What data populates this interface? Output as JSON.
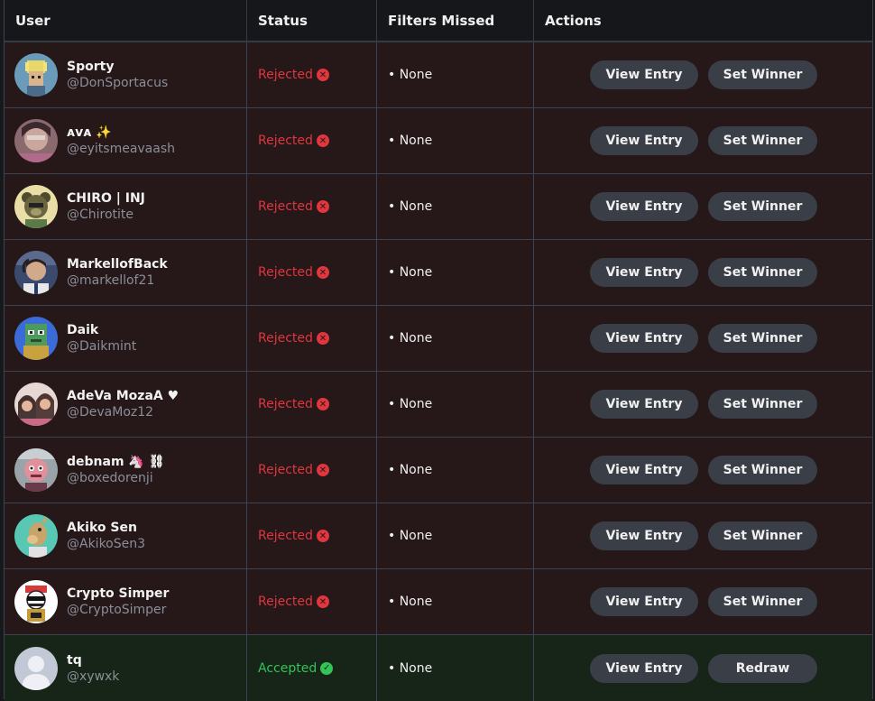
{
  "headers": {
    "user": "User",
    "status": "Status",
    "filters": "Filters Missed",
    "actions": "Actions"
  },
  "colors": {
    "rejected": "#e0363e",
    "accepted": "#33c457",
    "button_bg": "#3a3f47",
    "row_rejected_bg": "#261719",
    "row_accepted_bg": "#172418"
  },
  "rows": [
    {
      "name": "Sporty",
      "handle": "@DonSportacus",
      "status": "Rejected",
      "status_icon": "x-circle-icon",
      "filters": "• None",
      "view_label": "View Entry",
      "second_label": "Set Winner"
    },
    {
      "name": "ᴀᴠᴀ ✨",
      "handle": "@eyitsmeavaash",
      "status": "Rejected",
      "status_icon": "x-circle-icon",
      "filters": "• None",
      "view_label": "View Entry",
      "second_label": "Set Winner"
    },
    {
      "name": "CHIRO | INJ",
      "handle": "@Chirotite",
      "status": "Rejected",
      "status_icon": "x-circle-icon",
      "filters": "• None",
      "view_label": "View Entry",
      "second_label": "Set Winner"
    },
    {
      "name": "MarkellofBack",
      "handle": "@markellof21",
      "status": "Rejected",
      "status_icon": "x-circle-icon",
      "filters": "• None",
      "view_label": "View Entry",
      "second_label": "Set Winner"
    },
    {
      "name": "Daik",
      "handle": "@Daikmint",
      "status": "Rejected",
      "status_icon": "x-circle-icon",
      "filters": "• None",
      "view_label": "View Entry",
      "second_label": "Set Winner"
    },
    {
      "name": "AdeVa MozaA ♥",
      "handle": "@DevaMoz12",
      "status": "Rejected",
      "status_icon": "x-circle-icon",
      "filters": "• None",
      "view_label": "View Entry",
      "second_label": "Set Winner"
    },
    {
      "name": "debnam 🦄 ⛓",
      "handle": "@boxedorenji",
      "status": "Rejected",
      "status_icon": "x-circle-icon",
      "filters": "• None",
      "view_label": "View Entry",
      "second_label": "Set Winner"
    },
    {
      "name": "Akiko Sen",
      "handle": "@AkikoSen3",
      "status": "Rejected",
      "status_icon": "x-circle-icon",
      "filters": "• None",
      "view_label": "View Entry",
      "second_label": "Set Winner"
    },
    {
      "name": "Crypto Simper",
      "handle": "@CryptoSimper",
      "status": "Rejected",
      "status_icon": "x-circle-icon",
      "filters": "• None",
      "view_label": "View Entry",
      "second_label": "Set Winner"
    },
    {
      "name": "tq",
      "handle": "@xywxk",
      "status": "Accepted",
      "status_icon": "check-circle-icon",
      "filters": "• None",
      "view_label": "View Entry",
      "second_label": "Redraw"
    }
  ]
}
